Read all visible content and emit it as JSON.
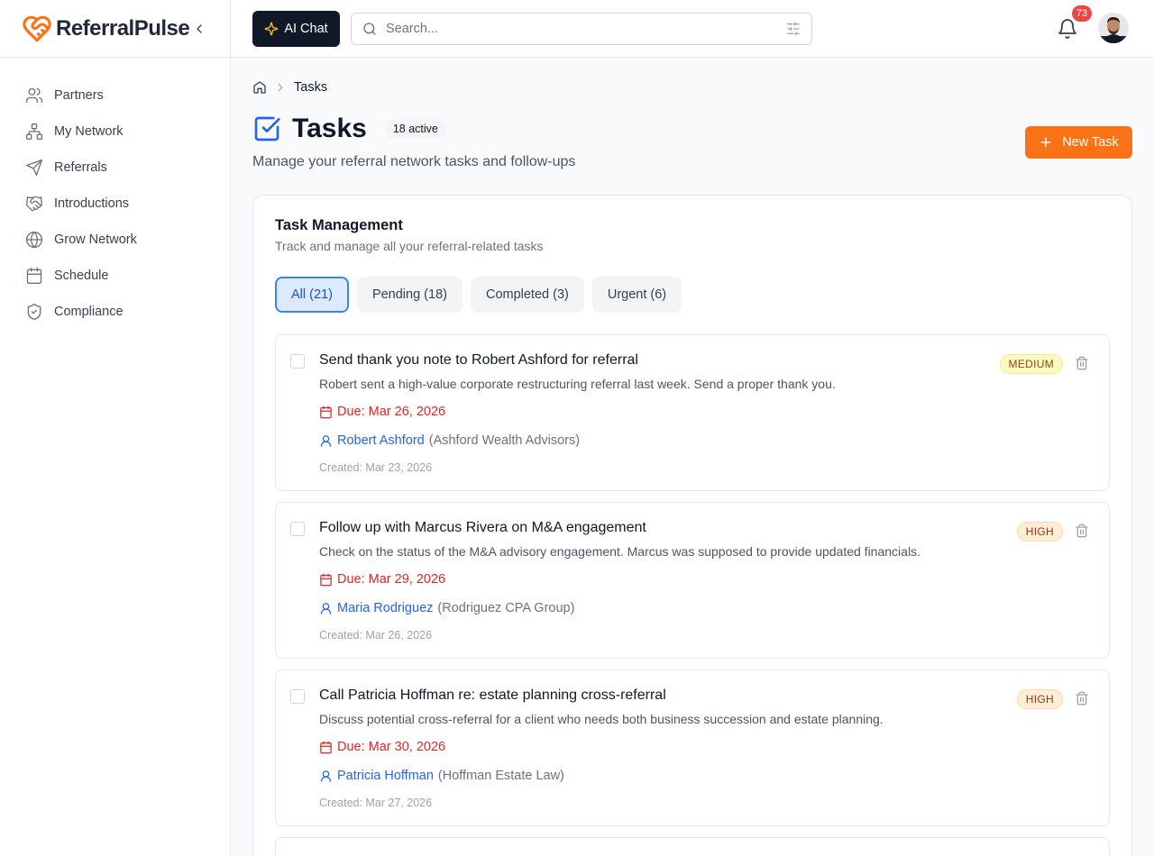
{
  "brand": {
    "name": "ReferralPulse"
  },
  "sidebar": {
    "items": [
      {
        "label": "Partners",
        "icon": "users-icon"
      },
      {
        "label": "My Network",
        "icon": "network-icon"
      },
      {
        "label": "Referrals",
        "icon": "send-icon"
      },
      {
        "label": "Introductions",
        "icon": "handshake-icon"
      },
      {
        "label": "Grow Network",
        "icon": "globe-icon"
      },
      {
        "label": "Schedule",
        "icon": "calendar-icon"
      },
      {
        "label": "Compliance",
        "icon": "shield-icon"
      }
    ]
  },
  "header": {
    "ai_chat_label": "AI Chat",
    "search_placeholder": "Search...",
    "notification_count": "73"
  },
  "breadcrumb": {
    "current": "Tasks"
  },
  "page": {
    "title": "Tasks",
    "active_badge": "18 active",
    "subtitle": "Manage your referral network tasks and follow-ups",
    "new_task_label": "New Task"
  },
  "card": {
    "title": "Task Management",
    "subtitle": "Track and manage all your referral-related tasks",
    "tabs": [
      {
        "label": "All (21)",
        "active": true
      },
      {
        "label": "Pending (18)",
        "active": false
      },
      {
        "label": "Completed (3)",
        "active": false
      },
      {
        "label": "Urgent (6)",
        "active": false
      }
    ]
  },
  "tasks": [
    {
      "title": "Send thank you note to Robert Ashford for referral",
      "description": "Robert sent a high-value corporate restructuring referral last week. Send a proper thank you.",
      "due": "Due: Mar 26, 2026",
      "person": "Robert Ashford",
      "org": "(Ashford Wealth Advisors)",
      "created": "Created: Mar 23, 2026",
      "priority": "MEDIUM"
    },
    {
      "title": "Follow up with Marcus Rivera on M&A engagement",
      "description": "Check on the status of the M&A advisory engagement. Marcus was supposed to provide updated financials.",
      "due": "Due: Mar 29, 2026",
      "person": "Maria Rodriguez",
      "org": "(Rodriguez CPA Group)",
      "created": "Created: Mar 26, 2026",
      "priority": "HIGH"
    },
    {
      "title": "Call Patricia Hoffman re: estate planning cross-referral",
      "description": "Discuss potential cross-referral for a client who needs both business succession and estate planning.",
      "due": "Due: Mar 30, 2026",
      "person": "Patricia Hoffman",
      "org": "(Hoffman Estate Law)",
      "created": "Created: Mar 27, 2026",
      "priority": "HIGH"
    }
  ],
  "colors": {
    "brand_orange": "#f97316",
    "accent_blue": "#2563eb",
    "due_red": "#dc2626"
  }
}
